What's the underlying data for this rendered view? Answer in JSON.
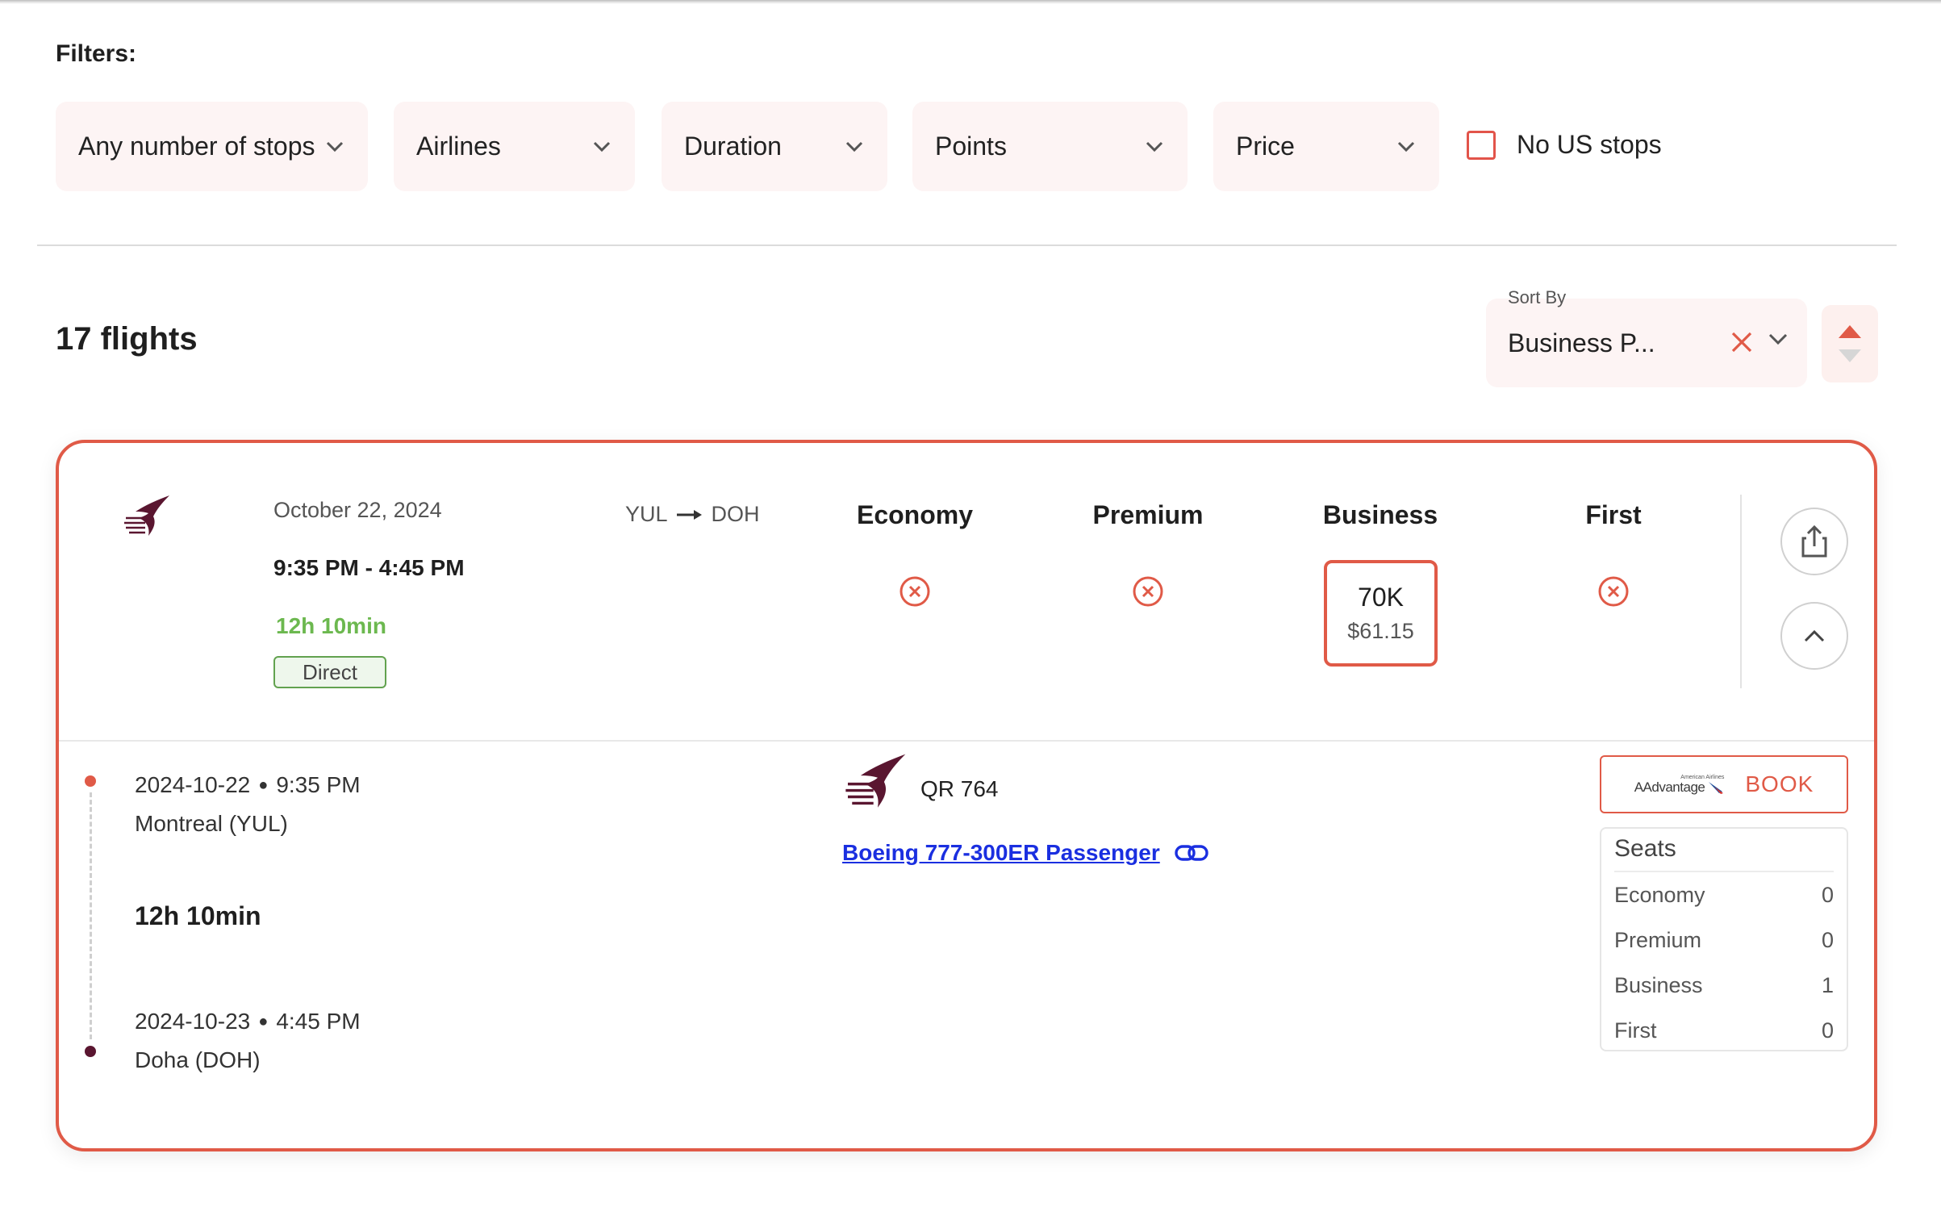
{
  "filters": {
    "label": "Filters:",
    "stops": "Any number of stops",
    "airlines": "Airlines",
    "duration": "Duration",
    "points": "Points",
    "price": "Price",
    "no_us_stops": "No US stops",
    "no_us_stops_checked": false
  },
  "results": {
    "count_label": "17 flights"
  },
  "sort": {
    "label": "Sort By",
    "value": "Business P..."
  },
  "flight": {
    "date": "October 22, 2024",
    "time": "9:35 PM - 4:45 PM",
    "duration": "12h 10min",
    "stops_badge": "Direct",
    "origin": "YUL",
    "destination": "DOH",
    "classes": {
      "economy": {
        "label": "Economy",
        "available": false
      },
      "premium": {
        "label": "Premium",
        "available": false
      },
      "business": {
        "label": "Business",
        "available": true,
        "points": "70K",
        "cash": "$61.15"
      },
      "first": {
        "label": "First",
        "available": false
      }
    }
  },
  "segment": {
    "departure_date": "2024-10-22",
    "departure_time": "9:35 PM",
    "departure_place": "Montreal (YUL)",
    "duration": "12h 10min",
    "arrival_date": "2024-10-23",
    "arrival_time": "4:45 PM",
    "arrival_place": "Doha (DOH)",
    "flight_number": "QR 764",
    "aircraft": "Boeing 777-300ER Passenger"
  },
  "booking": {
    "program_small": "American Airlines",
    "program_name": "AAdvantage",
    "book_label": "BOOK"
  },
  "seats": {
    "title": "Seats",
    "rows": [
      {
        "label": "Economy",
        "count": "0"
      },
      {
        "label": "Premium",
        "count": "0"
      },
      {
        "label": "Business",
        "count": "1"
      },
      {
        "label": "First",
        "count": "0"
      }
    ]
  },
  "colors": {
    "accent": "#e05a47",
    "filter_bg": "#fdf4f4",
    "duration_green": "#6cb84f",
    "link_blue": "#1a2fe0",
    "airline_maroon": "#5a1630"
  },
  "icons": {
    "chevron": "chevron-down-icon",
    "clear": "close-icon",
    "sort_order": "sort-arrows-icon",
    "unavailable": "x-circle-icon",
    "share": "share-icon",
    "collapse": "chevron-up-icon",
    "link": "link-icon",
    "airline": "qatar-airways-logo"
  }
}
